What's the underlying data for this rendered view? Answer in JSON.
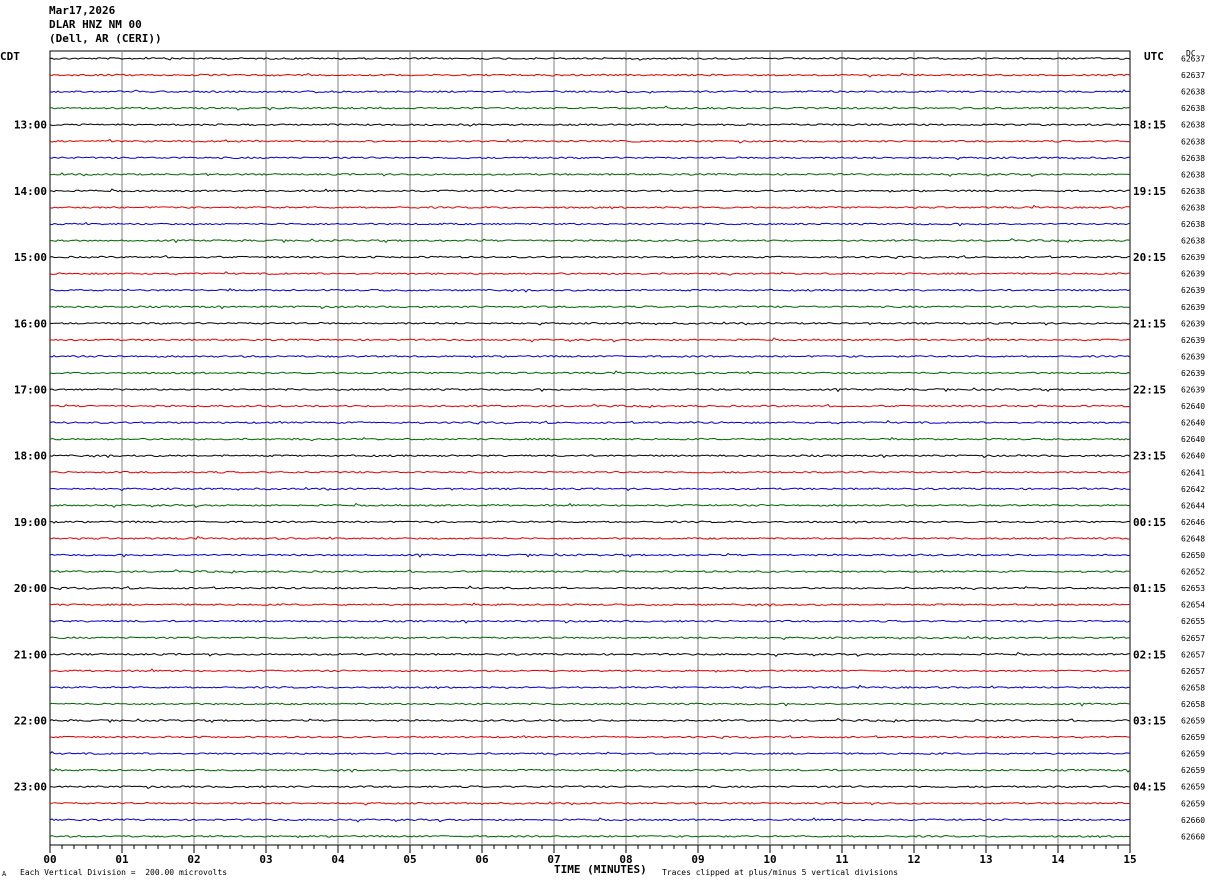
{
  "header": {
    "date": "Mar17,2026",
    "station": "DLAR HNZ NM 00",
    "location": "(Dell, AR (CERI))"
  },
  "left_axis_label": "CDT",
  "right_axis_label": "UTC",
  "dc_label": "DC",
  "footer": {
    "left_mark": "A",
    "scale_note": "Each Vertical Division =  200.00 microvolts",
    "xlabel": "TIME (MINUTES)",
    "clip_note": "Traces clipped at plus/minus 5 vertical divisions"
  },
  "colors": {
    "trace_cycle": [
      "#000000",
      "#e00000",
      "#0000cc",
      "#006400"
    ],
    "grid": "#808080"
  },
  "chart_data": {
    "type": "line",
    "title": "",
    "xlabel": "TIME (MINUTES)",
    "ylabel": "",
    "xlim": [
      0,
      15
    ],
    "x_ticks": [
      "00",
      "01",
      "02",
      "03",
      "04",
      "05",
      "06",
      "07",
      "08",
      "09",
      "10",
      "11",
      "12",
      "13",
      "14",
      "15"
    ],
    "trace_count": 48,
    "left_hour_labels": [
      "13:00",
      "14:00",
      "15:00",
      "16:00",
      "17:00",
      "18:00",
      "19:00",
      "20:00",
      "21:00",
      "22:00",
      "23:00"
    ],
    "right_hour_labels": [
      "18:15",
      "19:15",
      "20:15",
      "21:15",
      "22:15",
      "23:15",
      "00:15",
      "01:15",
      "02:15",
      "03:15",
      "04:15"
    ],
    "dc_offsets": [
      "62637",
      "62637",
      "62638",
      "62638",
      "62638",
      "62638",
      "62638",
      "62638",
      "62638",
      "62638",
      "62638",
      "62638",
      "62639",
      "62639",
      "62639",
      "62639",
      "62639",
      "62639",
      "62639",
      "62639",
      "62639",
      "62640",
      "62640",
      "62640",
      "62640",
      "62641",
      "62642",
      "62644",
      "62646",
      "62648",
      "62650",
      "62652",
      "62653",
      "62654",
      "62655",
      "62657",
      "62657",
      "62657",
      "62658",
      "62658",
      "62659",
      "62659",
      "62659",
      "62659",
      "62659",
      "62659",
      "62660",
      "62660"
    ]
  }
}
